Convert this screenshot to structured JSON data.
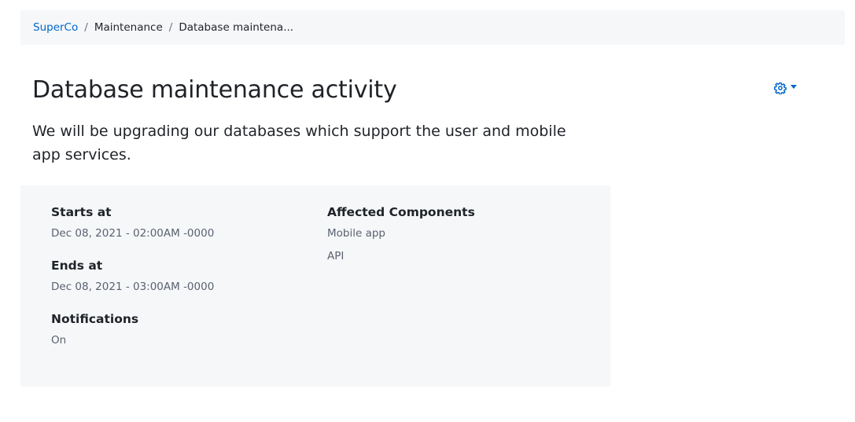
{
  "breadcrumb": {
    "items": [
      "SuperCo",
      "Maintenance",
      "Database maintena..."
    ],
    "separator": "/"
  },
  "page": {
    "title": "Database maintenance activity",
    "description": "We will be upgrading our databases which support the user and mobile app services."
  },
  "actions": {
    "menu_icon": "gear-icon"
  },
  "details": {
    "starts_at": {
      "label": "Starts at",
      "value": "Dec 08, 2021 - 02:00AM -0000"
    },
    "ends_at": {
      "label": "Ends at",
      "value": "Dec 08, 2021 - 03:00AM -0000"
    },
    "notifications": {
      "label": "Notifications",
      "value": "On"
    },
    "affected_components": {
      "label": "Affected Components",
      "items": [
        "Mobile app",
        "API"
      ]
    }
  },
  "colors": {
    "link": "#0066cc",
    "panel_bg": "#f6f7f9",
    "text": "#1f2328",
    "muted_text": "#5a6270"
  }
}
